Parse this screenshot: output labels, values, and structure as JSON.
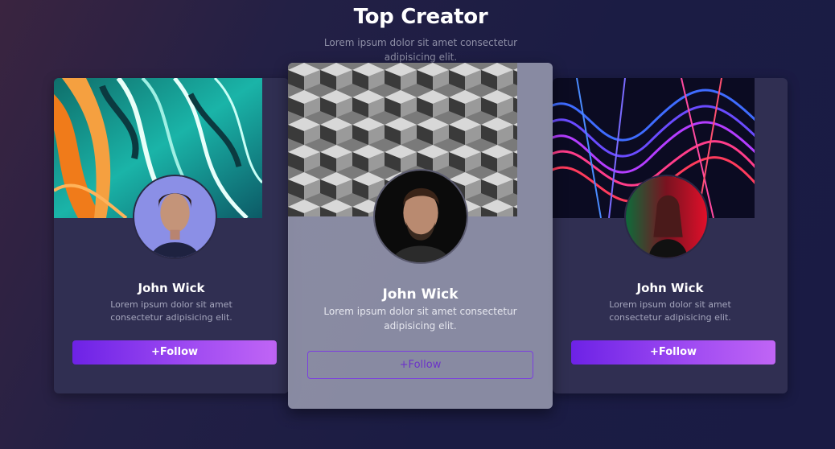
{
  "header": {
    "title": "Top Creator",
    "subtitle": "Lorem ipsum dolor sit amet consectetur adipisicing elit."
  },
  "cards": [
    {
      "name": "John Wick",
      "description": "Lorem ipsum dolor sit amet consectetur adipisicing elit.",
      "button": "+Follow"
    },
    {
      "name": "John Wick",
      "description": "Lorem ipsum dolor sit amet consectetur adipisicing elit.",
      "button": "+Follow"
    },
    {
      "name": "John Wick",
      "description": "Lorem ipsum dolor sit amet consectetur adipisicing elit.",
      "button": "+Follow"
    }
  ],
  "colors": {
    "background": "#1b1c44",
    "card": "#302f52",
    "accent_start": "#6d22e6",
    "accent_end": "#c065f5"
  }
}
